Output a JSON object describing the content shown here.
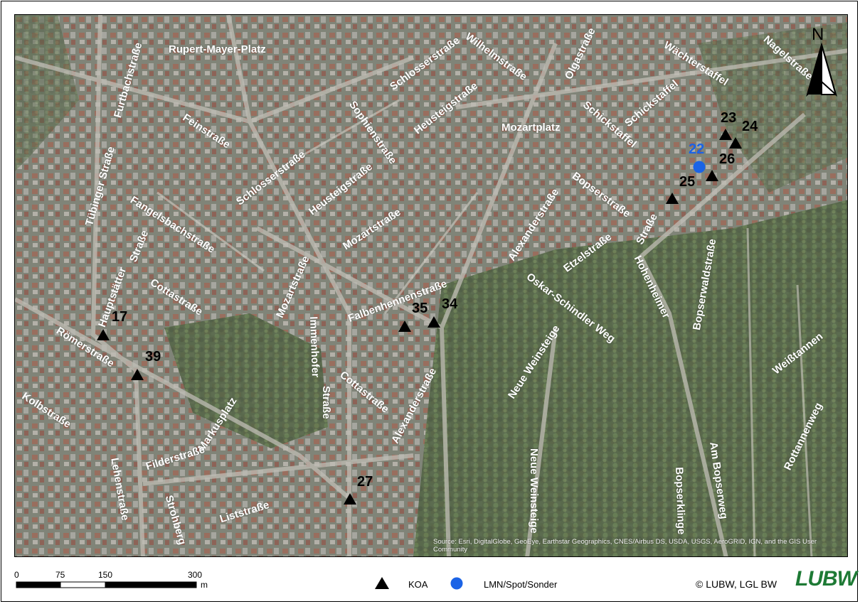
{
  "map": {
    "streets": [
      {
        "id": "rupert-mayer-platz",
        "text": "Rupert-Mayer-Platz"
      },
      {
        "id": "furtbachstrasse",
        "text": "Furtbachstraße"
      },
      {
        "id": "feinstrasse",
        "text": "Feinstraße"
      },
      {
        "id": "schlosserstrasse-top",
        "text": "Schlosserstraße"
      },
      {
        "id": "wilhelmstrasse",
        "text": "Wilhelmstraße"
      },
      {
        "id": "olgastrasse",
        "text": "Olgastraße"
      },
      {
        "id": "waechterstaffel",
        "text": "Wächterstaffel"
      },
      {
        "id": "nagelstrasse",
        "text": "Nagelstraße"
      },
      {
        "id": "sophienstrasse",
        "text": "Sophienstraße"
      },
      {
        "id": "heusteigstrasse-top",
        "text": "Heusteigstraße"
      },
      {
        "id": "schickstaffel",
        "text": "Schickstaffel"
      },
      {
        "id": "schickstaffel-2",
        "text": "Schickstaffel"
      },
      {
        "id": "mozartplatz",
        "text": "Mozartplatz"
      },
      {
        "id": "tuebinger-strasse",
        "text": "Tübinger Straße"
      },
      {
        "id": "schlosserstrasse-mid",
        "text": "Schlosserstraße"
      },
      {
        "id": "heusteigstrasse-mid",
        "text": "Heusteigstraße"
      },
      {
        "id": "fangelsbachstrasse",
        "text": "Fangelsbachstraße"
      },
      {
        "id": "mozartstrasse-top",
        "text": "Mozartstraße"
      },
      {
        "id": "alexanderstrasse-top",
        "text": "Alexanderstraße"
      },
      {
        "id": "bopserstrasse",
        "text": "Bopserstraße"
      },
      {
        "id": "etzelstrasse",
        "text": "Etzelstraße"
      },
      {
        "id": "hohenheimer-strasse-1",
        "text": "Straße"
      },
      {
        "id": "hohenheimer-strasse-2",
        "text": "Hohenheimer"
      },
      {
        "id": "bopserwaldstrasse",
        "text": "Bopserwaldstraße"
      },
      {
        "id": "hauptstaetter-strasse-1",
        "text": "Straße"
      },
      {
        "id": "hauptstaetter-strasse-2",
        "text": "Hauptstätter"
      },
      {
        "id": "cottastrasse-left",
        "text": "Cottastraße"
      },
      {
        "id": "mozartstrasse-mid",
        "text": "Mozartstraße"
      },
      {
        "id": "falbenhennenstrasse",
        "text": "Falbenhennenstraße"
      },
      {
        "id": "oskar-schindler-weg",
        "text": "Oskar-Schindler Weg"
      },
      {
        "id": "immenhofer-strasse-1",
        "text": "Immenhofer"
      },
      {
        "id": "immenhofer-strasse-2",
        "text": "Straße"
      },
      {
        "id": "roemerstrasse",
        "text": "Römerstraße"
      },
      {
        "id": "cottastrasse-mid",
        "text": "Cottastraße"
      },
      {
        "id": "alexanderstrasse-bottom",
        "text": "Alexanderstraße"
      },
      {
        "id": "neue-weinsteige-1",
        "text": "Neue Weinsteige"
      },
      {
        "id": "weisstannen",
        "text": "Weißtannen"
      },
      {
        "id": "kolbstrasse",
        "text": "Kolbstraße"
      },
      {
        "id": "markusplatz",
        "text": "Markusplatz"
      },
      {
        "id": "rottannenweg",
        "text": "Rottannenweg"
      },
      {
        "id": "filderstrasse",
        "text": "Filderstraße"
      },
      {
        "id": "lehenstrasse",
        "text": "Lehenstraße"
      },
      {
        "id": "strohberg",
        "text": "Strohberg"
      },
      {
        "id": "liststrasse",
        "text": "Liststraße"
      },
      {
        "id": "neue-weinsteige-2",
        "text": "Neue Weinsteige"
      },
      {
        "id": "bopserklinge",
        "text": "Bopserklinge"
      },
      {
        "id": "am-bopserweg",
        "text": "Am Bopserweg"
      }
    ],
    "sites": [
      {
        "id": "17",
        "label": "17",
        "type": "KOA"
      },
      {
        "id": "39",
        "label": "39",
        "type": "KOA"
      },
      {
        "id": "35",
        "label": "35",
        "type": "KOA"
      },
      {
        "id": "34",
        "label": "34",
        "type": "KOA"
      },
      {
        "id": "27",
        "label": "27",
        "type": "KOA"
      },
      {
        "id": "23",
        "label": "23",
        "type": "KOA"
      },
      {
        "id": "24",
        "label": "24",
        "type": "KOA"
      },
      {
        "id": "26",
        "label": "26",
        "type": "KOA"
      },
      {
        "id": "25",
        "label": "25",
        "type": "KOA"
      },
      {
        "id": "22",
        "label": "22",
        "type": "LMN/Spot/Sonder"
      }
    ],
    "north_label": "N",
    "attribution": "Source: Esri, DigitalGlobe, GeoEye, Earthstar Geographics, CNES/Airbus DS, USDA, USGS, AeroGRID, IGN, and the GIS User Community"
  },
  "footer": {
    "scale": {
      "ticks": [
        "0",
        "75",
        "150",
        "300"
      ],
      "unit": "m"
    },
    "legend": [
      {
        "symbol": "triangle",
        "label": "KOA",
        "color": "#000000"
      },
      {
        "symbol": "circle",
        "label": "LMN/Spot/Sonder",
        "color": "#1b63e6"
      }
    ],
    "copyright": "© LUBW, LGL BW",
    "logo": "LUBW"
  },
  "colors": {
    "koa": "#000000",
    "spot": "#1b63e6",
    "logo": "#1e7a35"
  }
}
